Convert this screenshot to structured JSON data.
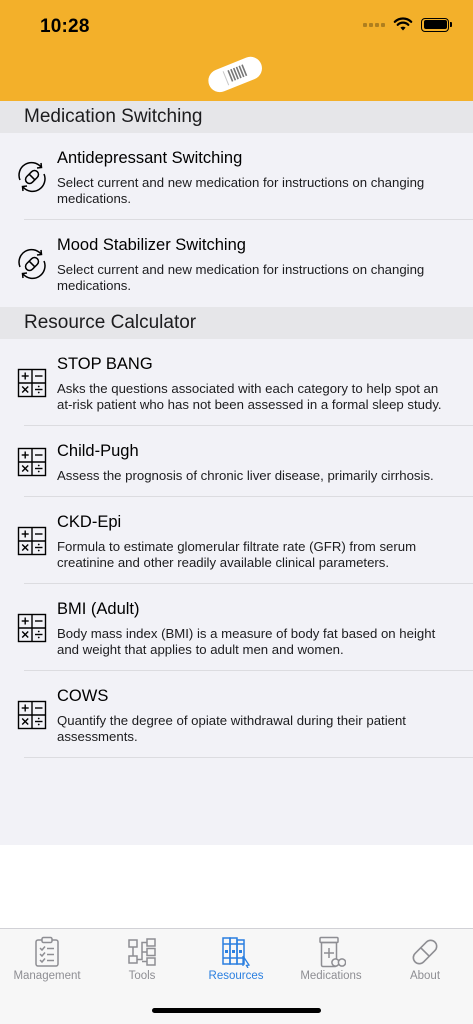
{
  "status": {
    "time": "10:28"
  },
  "icons": {
    "logo": "pill-logo-icon",
    "switching": "medication-switch-icon",
    "calculator": "calculator-icon"
  },
  "colors": {
    "header": "#f3b02a",
    "accent": "#2a7fe0",
    "inactive": "#8e8e93",
    "list_bg": "#f2f2f7",
    "section_bg": "#e6e6e9"
  },
  "sections": [
    {
      "title": "Medication Switching",
      "items": [
        {
          "title": "Antidepressant Switching",
          "desc": "Select current and new medication for instructions on changing medications."
        },
        {
          "title": "Mood Stabilizer Switching",
          "desc": "Select current and new medication for instructions on changing medications."
        }
      ]
    },
    {
      "title": "Resource Calculator",
      "items": [
        {
          "title": "STOP BANG",
          "desc": "Asks the questions associated with each category to help spot an at-risk patient who has not been assessed in a formal sleep study."
        },
        {
          "title": "Child-Pugh",
          "desc": "Assess the prognosis of chronic liver disease, primarily cirrhosis."
        },
        {
          "title": "CKD-Epi",
          "desc": "Formula to estimate glomerular filtrate rate (GFR) from serum creatinine and other readily available clinical parameters."
        },
        {
          "title": "BMI (Adult)",
          "desc": "Body mass index (BMI) is a measure of body fat based on height and weight that applies to adult men and women."
        },
        {
          "title": "COWS",
          "desc": "Quantify the degree of opiate withdrawal during their patient assessments."
        }
      ]
    }
  ],
  "tabs": [
    {
      "label": "Management",
      "icon": "clipboard-icon",
      "active": false
    },
    {
      "label": "Tools",
      "icon": "flowchart-icon",
      "active": false
    },
    {
      "label": "Resources",
      "icon": "books-icon",
      "active": true
    },
    {
      "label": "Medications",
      "icon": "pill-bottle-icon",
      "active": false
    },
    {
      "label": "About",
      "icon": "pill-icon",
      "active": false
    }
  ]
}
